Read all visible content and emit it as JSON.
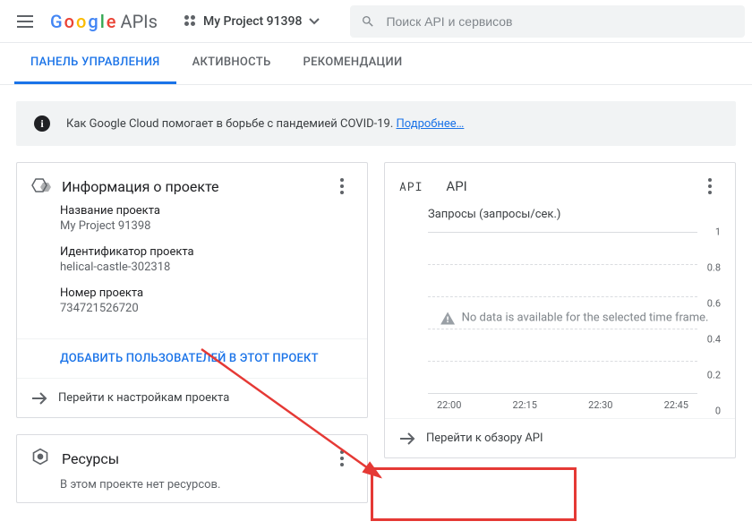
{
  "header": {
    "logo_apis": "APIs",
    "project_name": "My Project 91398",
    "search_placeholder": "Поиск API и сервисов"
  },
  "tabs": {
    "dashboard": "ПАНЕЛЬ УПРАВЛЕНИЯ",
    "activity": "АКТИВНОСТЬ",
    "recommendations": "РЕКОМЕНДАЦИИ"
  },
  "banner": {
    "text": "Как Google Cloud помогает в борьбе с пандемией COVID-19. ",
    "link": "Подробнее…"
  },
  "project_card": {
    "title": "Информация о проекте",
    "name_label": "Название проекта",
    "name_value": "My Project 91398",
    "id_label": "Идентификатор проекта",
    "id_value": "helical-castle-302318",
    "number_label": "Номер проекта",
    "number_value": "734721526720",
    "add_users": "ДОБАВИТЬ ПОЛЬЗОВАТЕЛЕЙ В ЭТОТ ПРОЕКТ",
    "go_settings": "Перейти к настройкам проекта"
  },
  "resources_card": {
    "title": "Ресурсы",
    "empty": "В этом проекте нет ресурсов."
  },
  "api_card": {
    "badge": "API",
    "title": "API",
    "chart_title": "Запросы (запросы/сек.)",
    "no_data": "No data is available for the selected time frame.",
    "go_overview": "Перейти к обзору API"
  },
  "chart_data": {
    "type": "line",
    "title": "Запросы (запросы/сек.)",
    "xlabel": "",
    "ylabel": "",
    "ylim": [
      0,
      1
    ],
    "yticks": [
      1,
      0.8,
      0.6,
      0.4,
      0.2,
      0
    ],
    "x": [
      "22:00",
      "22:15",
      "22:30",
      "22:45"
    ],
    "series": [
      {
        "name": "Запросы",
        "values": [
          null,
          null,
          null,
          null
        ]
      }
    ]
  }
}
